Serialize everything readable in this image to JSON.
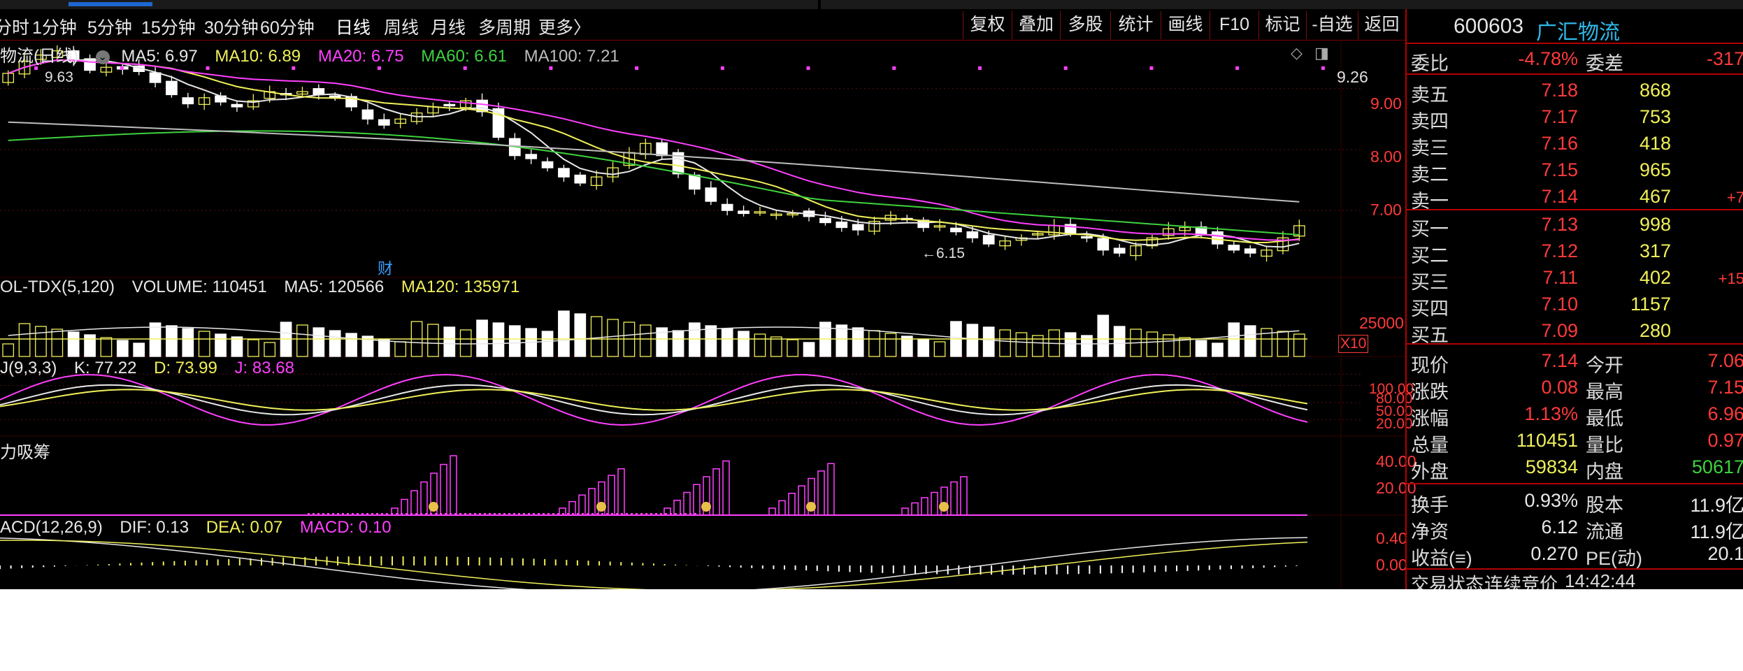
{
  "toolbar": {
    "periods": [
      "分时",
      "1分钟",
      "5分钟",
      "15分钟",
      "30分钟",
      "60分钟",
      "日线",
      "周线",
      "月线",
      "多周期",
      "更多〉"
    ],
    "active_period": "日线",
    "right_buttons": [
      "复权",
      "叠加",
      "多股",
      "统计",
      "画线",
      "F10",
      "标记",
      "-自选",
      "返回"
    ]
  },
  "main_legend": {
    "title": "物流(日线)",
    "ma5": "MA5: 6.97",
    "ma10": "MA10: 6.89",
    "ma20": "MA20: 6.75",
    "ma60": "MA60: 6.61",
    "ma100": "MA100: 7.21"
  },
  "vol_legend": {
    "title": "OL-TDX(5,120)",
    "volume": "VOLUME: 110451",
    "ma5": "MA5: 120566",
    "ma120": "MA120: 135971"
  },
  "kdj_legend": {
    "title": "J(9,3,3)",
    "k": "K: 77.22",
    "d": "D: 73.99",
    "j": "J: 83.68"
  },
  "flow_legend": {
    "title": "力吸筹"
  },
  "macd_legend": {
    "title": "ACD(12,26,9)",
    "dif": "DIF: 0.13",
    "dea": "DEA: 0.07",
    "macd": "MACD: 0.10"
  },
  "annotations": {
    "high_label": "9.63",
    "low_label": "6.15",
    "finance_mark": "财",
    "vol_scale": "X10",
    "top_price": "9.26"
  },
  "colors": {
    "ma5": "#e8e8e8",
    "ma10": "#f0f05a",
    "ma20": "#ff40ff",
    "ma60": "#3ed23e",
    "ma100": "#bdbdbd",
    "up": "#f0f05a",
    "down": "#ffffff",
    "axis_red": "#ff3a3a",
    "flow": "#ff40ff"
  },
  "stock": {
    "code": "600603",
    "name": "广汇物流"
  },
  "quote": {
    "weibi_label": "委比",
    "weibi_value": "-4.78%",
    "weicha_label": "委差",
    "weicha_value": "-317",
    "sell": [
      {
        "label": "卖五",
        "price": "7.18",
        "vol": "868",
        "chg": ""
      },
      {
        "label": "卖四",
        "price": "7.17",
        "vol": "753",
        "chg": ""
      },
      {
        "label": "卖三",
        "price": "7.16",
        "vol": "418",
        "chg": ""
      },
      {
        "label": "卖二",
        "price": "7.15",
        "vol": "965",
        "chg": ""
      },
      {
        "label": "卖一",
        "price": "7.14",
        "vol": "467",
        "chg": "+7"
      }
    ],
    "buy": [
      {
        "label": "买一",
        "price": "7.13",
        "vol": "998",
        "chg": ""
      },
      {
        "label": "买二",
        "price": "7.12",
        "vol": "317",
        "chg": ""
      },
      {
        "label": "买三",
        "price": "7.11",
        "vol": "402",
        "chg": "+15"
      },
      {
        "label": "买四",
        "price": "7.10",
        "vol": "1157",
        "chg": ""
      },
      {
        "label": "买五",
        "price": "7.09",
        "vol": "280",
        "chg": ""
      }
    ],
    "stats": [
      {
        "l1": "现价",
        "v1": "7.14",
        "l2": "今开",
        "v2": "7.06"
      },
      {
        "l1": "涨跌",
        "v1": "0.08",
        "l2": "最高",
        "v2": "7.15"
      },
      {
        "l1": "涨幅",
        "v1": "1.13%",
        "l2": "最低",
        "v2": "6.96"
      },
      {
        "l1": "总量",
        "v1": "110451",
        "l2": "量比",
        "v2": "0.97"
      },
      {
        "l1": "外盘",
        "v1": "59834",
        "l2": "内盘",
        "v2": "50617"
      }
    ],
    "stats2": [
      {
        "l1": "换手",
        "v1": "0.93%",
        "l2": "股本",
        "v2": "11.9亿"
      },
      {
        "l1": "净资",
        "v1": "6.12",
        "l2": "流通",
        "v2": "11.9亿"
      },
      {
        "l1": "收益(≡)",
        "v1": "0.270",
        "l2": "PE(动)",
        "v2": "20.1"
      }
    ],
    "status_label": "交易状态:",
    "status_value": "连续竞价",
    "status_time": "14:42:44"
  },
  "chart_data": [
    {
      "type": "candlestick",
      "title": "物流(日线)",
      "y_ticks": [
        7.0,
        8.0,
        9.0
      ],
      "y_top_label": 9.26,
      "ylim": [
        5.9,
        9.8
      ],
      "n_bars": 80,
      "closes": [
        9.25,
        9.45,
        9.55,
        9.62,
        9.45,
        9.3,
        9.35,
        9.32,
        9.28,
        9.1,
        8.9,
        8.75,
        8.85,
        8.78,
        8.7,
        8.8,
        8.95,
        8.9,
        8.95,
        8.9,
        8.85,
        8.7,
        8.5,
        8.4,
        8.5,
        8.6,
        8.7,
        8.72,
        8.8,
        8.62,
        8.2,
        7.9,
        7.85,
        7.7,
        7.55,
        7.45,
        7.55,
        7.7,
        7.95,
        8.1,
        7.9,
        7.6,
        7.35,
        7.15,
        7.0,
        6.95,
        6.98,
        6.94,
        6.95,
        6.9,
        6.8,
        6.72,
        6.68,
        6.82,
        6.92,
        6.85,
        6.72,
        6.75,
        6.65,
        6.55,
        6.45,
        6.5,
        6.55,
        6.62,
        6.75,
        6.62,
        6.55,
        6.35,
        6.3,
        6.42,
        6.55,
        6.7,
        6.72,
        6.6,
        6.45,
        6.35,
        6.3,
        6.35,
        6.55,
        6.75
      ],
      "series": [
        {
          "name": "MA5",
          "value": 6.97
        },
        {
          "name": "MA10",
          "value": 6.89
        },
        {
          "name": "MA20",
          "value": 6.75
        },
        {
          "name": "MA60",
          "value": 6.61
        },
        {
          "name": "MA100",
          "value": 7.21
        }
      ],
      "high_label": 9.63,
      "low_label": 6.15
    },
    {
      "type": "bar",
      "title": "OL-TDX(5,120)",
      "y_ticks": [
        25000
      ],
      "scale_label": "X10",
      "volume": 110451,
      "ma5": 120566,
      "ma120": 135971
    },
    {
      "type": "line",
      "title": "J(9,3,3)",
      "y_ticks": [
        20.0,
        50.0,
        80.0,
        100.0
      ],
      "series": [
        {
          "name": "K",
          "value": 77.22
        },
        {
          "name": "D",
          "value": 73.99
        },
        {
          "name": "J",
          "value": 83.68
        }
      ]
    },
    {
      "type": "bar",
      "title": "力吸筹",
      "y_ticks": [
        20.0,
        40.0
      ]
    },
    {
      "type": "bar",
      "title": "ACD(12,26,9)",
      "y_ticks": [
        0.0,
        0.4
      ],
      "series": [
        {
          "name": "DIF",
          "value": 0.13
        },
        {
          "name": "DEA",
          "value": 0.07
        },
        {
          "name": "MACD",
          "value": 0.1
        }
      ]
    }
  ]
}
